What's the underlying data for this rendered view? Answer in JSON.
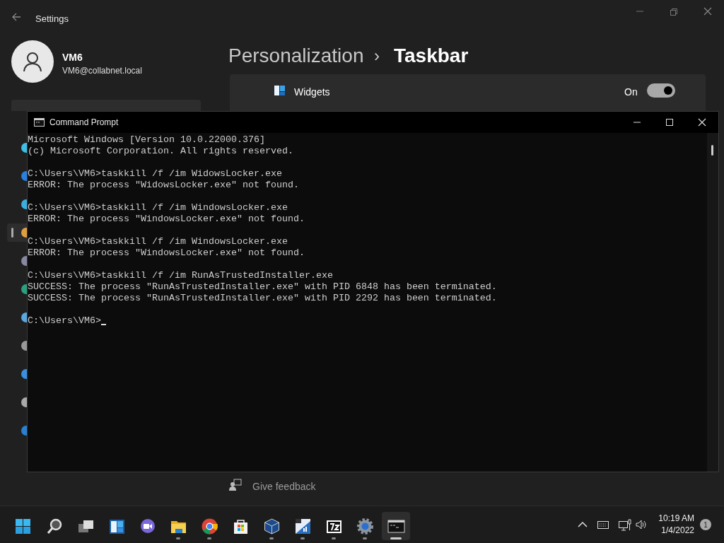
{
  "settings_window": {
    "title": "Settings",
    "user": {
      "name": "VM6",
      "email": "VM6@collabnet.local"
    },
    "sidebar": {
      "items": [
        {
          "selected": false
        },
        {
          "selected": false
        },
        {
          "selected": false
        },
        {
          "selected": true
        },
        {
          "selected": false
        },
        {
          "selected": false
        },
        {
          "selected": false
        },
        {
          "selected": false
        },
        {
          "selected": false
        },
        {
          "selected": false
        },
        {
          "selected": false
        }
      ]
    },
    "breadcrumb": {
      "parent": "Personalization",
      "separator": "›",
      "current": "Taskbar"
    },
    "setting_row": {
      "label": "Widgets",
      "state_text": "On",
      "on": true
    },
    "feedback_link": "Give feedback"
  },
  "command_prompt": {
    "title": "Command Prompt",
    "blocks": [
      [
        "Microsoft Windows [Version 10.0.22000.376]",
        "(c) Microsoft Corporation. All rights reserved."
      ],
      [
        "C:\\Users\\VM6>taskkill /f /im WidowsLocker.exe",
        "ERROR: The process \"WidowsLocker.exe\" not found."
      ],
      [
        "C:\\Users\\VM6>taskkill /f /im WindowsLocker.exe",
        "ERROR: The process \"WindowsLocker.exe\" not found."
      ],
      [
        "C:\\Users\\VM6>taskkill /f /im WindowsLocker.exe",
        "ERROR: The process \"WindowsLocker.exe\" not found."
      ],
      [
        "C:\\Users\\VM6>taskkill /f /im RunAsTrustedInstaller.exe",
        "SUCCESS: The process \"RunAsTrustedInstaller.exe\" with PID 6848 has been terminated.",
        "SUCCESS: The process \"RunAsTrustedInstaller.exe\" with PID 2292 has been terminated."
      ],
      [
        "C:\\Users\\VM6>"
      ]
    ]
  },
  "taskbar": {
    "apps": [
      {
        "kind": "start",
        "running": false,
        "active": false
      },
      {
        "kind": "search",
        "running": false,
        "active": false
      },
      {
        "kind": "taskview",
        "running": false,
        "active": false
      },
      {
        "kind": "widgets",
        "running": false,
        "active": false
      },
      {
        "kind": "chat",
        "running": false,
        "active": false
      },
      {
        "kind": "folder",
        "running": true,
        "active": false
      },
      {
        "kind": "browser",
        "running": true,
        "active": false
      },
      {
        "kind": "store",
        "running": false,
        "active": false
      },
      {
        "kind": "cube",
        "running": true,
        "active": false
      },
      {
        "kind": "chart",
        "running": true,
        "active": false
      },
      {
        "kind": "archive",
        "running": true,
        "active": false
      },
      {
        "kind": "gear",
        "running": true,
        "active": false
      },
      {
        "kind": "terminal",
        "running": true,
        "active": true
      }
    ],
    "time": "10:19 AM",
    "date": "1/4/2022",
    "notification_count": "1"
  }
}
